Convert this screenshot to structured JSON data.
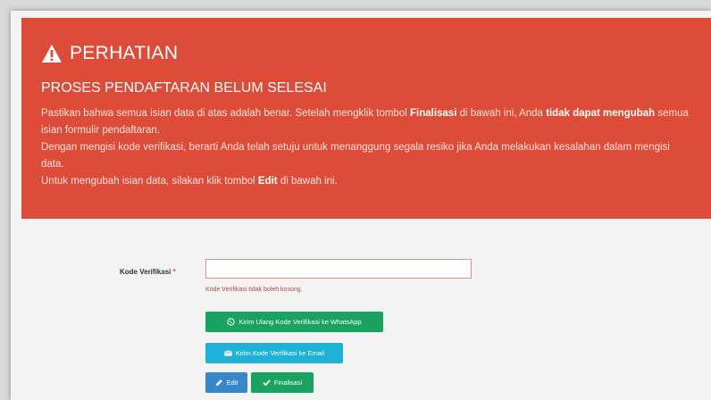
{
  "alert": {
    "title": "PERHATIAN",
    "subtitle": "PROSES PENDAFTARAN BELUM SELESAI",
    "p1_pre": "Pastikan bahwa semua isian data di atas adalah benar. Setelah mengklik tombol ",
    "p1_bold1": "Finalisasi",
    "p1_mid": " di bawah ini, Anda ",
    "p1_bold2": "tidak dapat mengubah",
    "p1_post": " semua isian formulir pendaftaran.",
    "p2": "Dengan mengisi kode verifikasi, berarti Anda telah setuju untuk menanggung segala resiko jika Anda melakukan kesalahan dalam mengisi data.",
    "p3_pre": "Untuk mengubah isian data, silakan klik tombol ",
    "p3_bold": "Edit",
    "p3_post": " di bawah ini."
  },
  "form": {
    "label": "Kode Verifikasi",
    "required_mark": "*",
    "input_value": "",
    "help_text": "Kode Verifikasi tidak boleh kosong."
  },
  "buttons": {
    "whatsapp": "Kirim Ulang Kode Verifikasi ke WhatsApp",
    "email": "Kirim Kode Verifikasi ke Email",
    "edit": "Edit",
    "finalisasi": "Finalisasi"
  },
  "colors": {
    "alert_bg": "#dd4b39",
    "success": "#1aa260",
    "info": "#1fb2d8",
    "primary": "#3a87c8"
  },
  "icons": {
    "title": "warning-icon",
    "whatsapp": "whatsapp-icon",
    "email": "envelope-icon",
    "edit": "pencil-icon",
    "finalisasi": "check-icon"
  }
}
